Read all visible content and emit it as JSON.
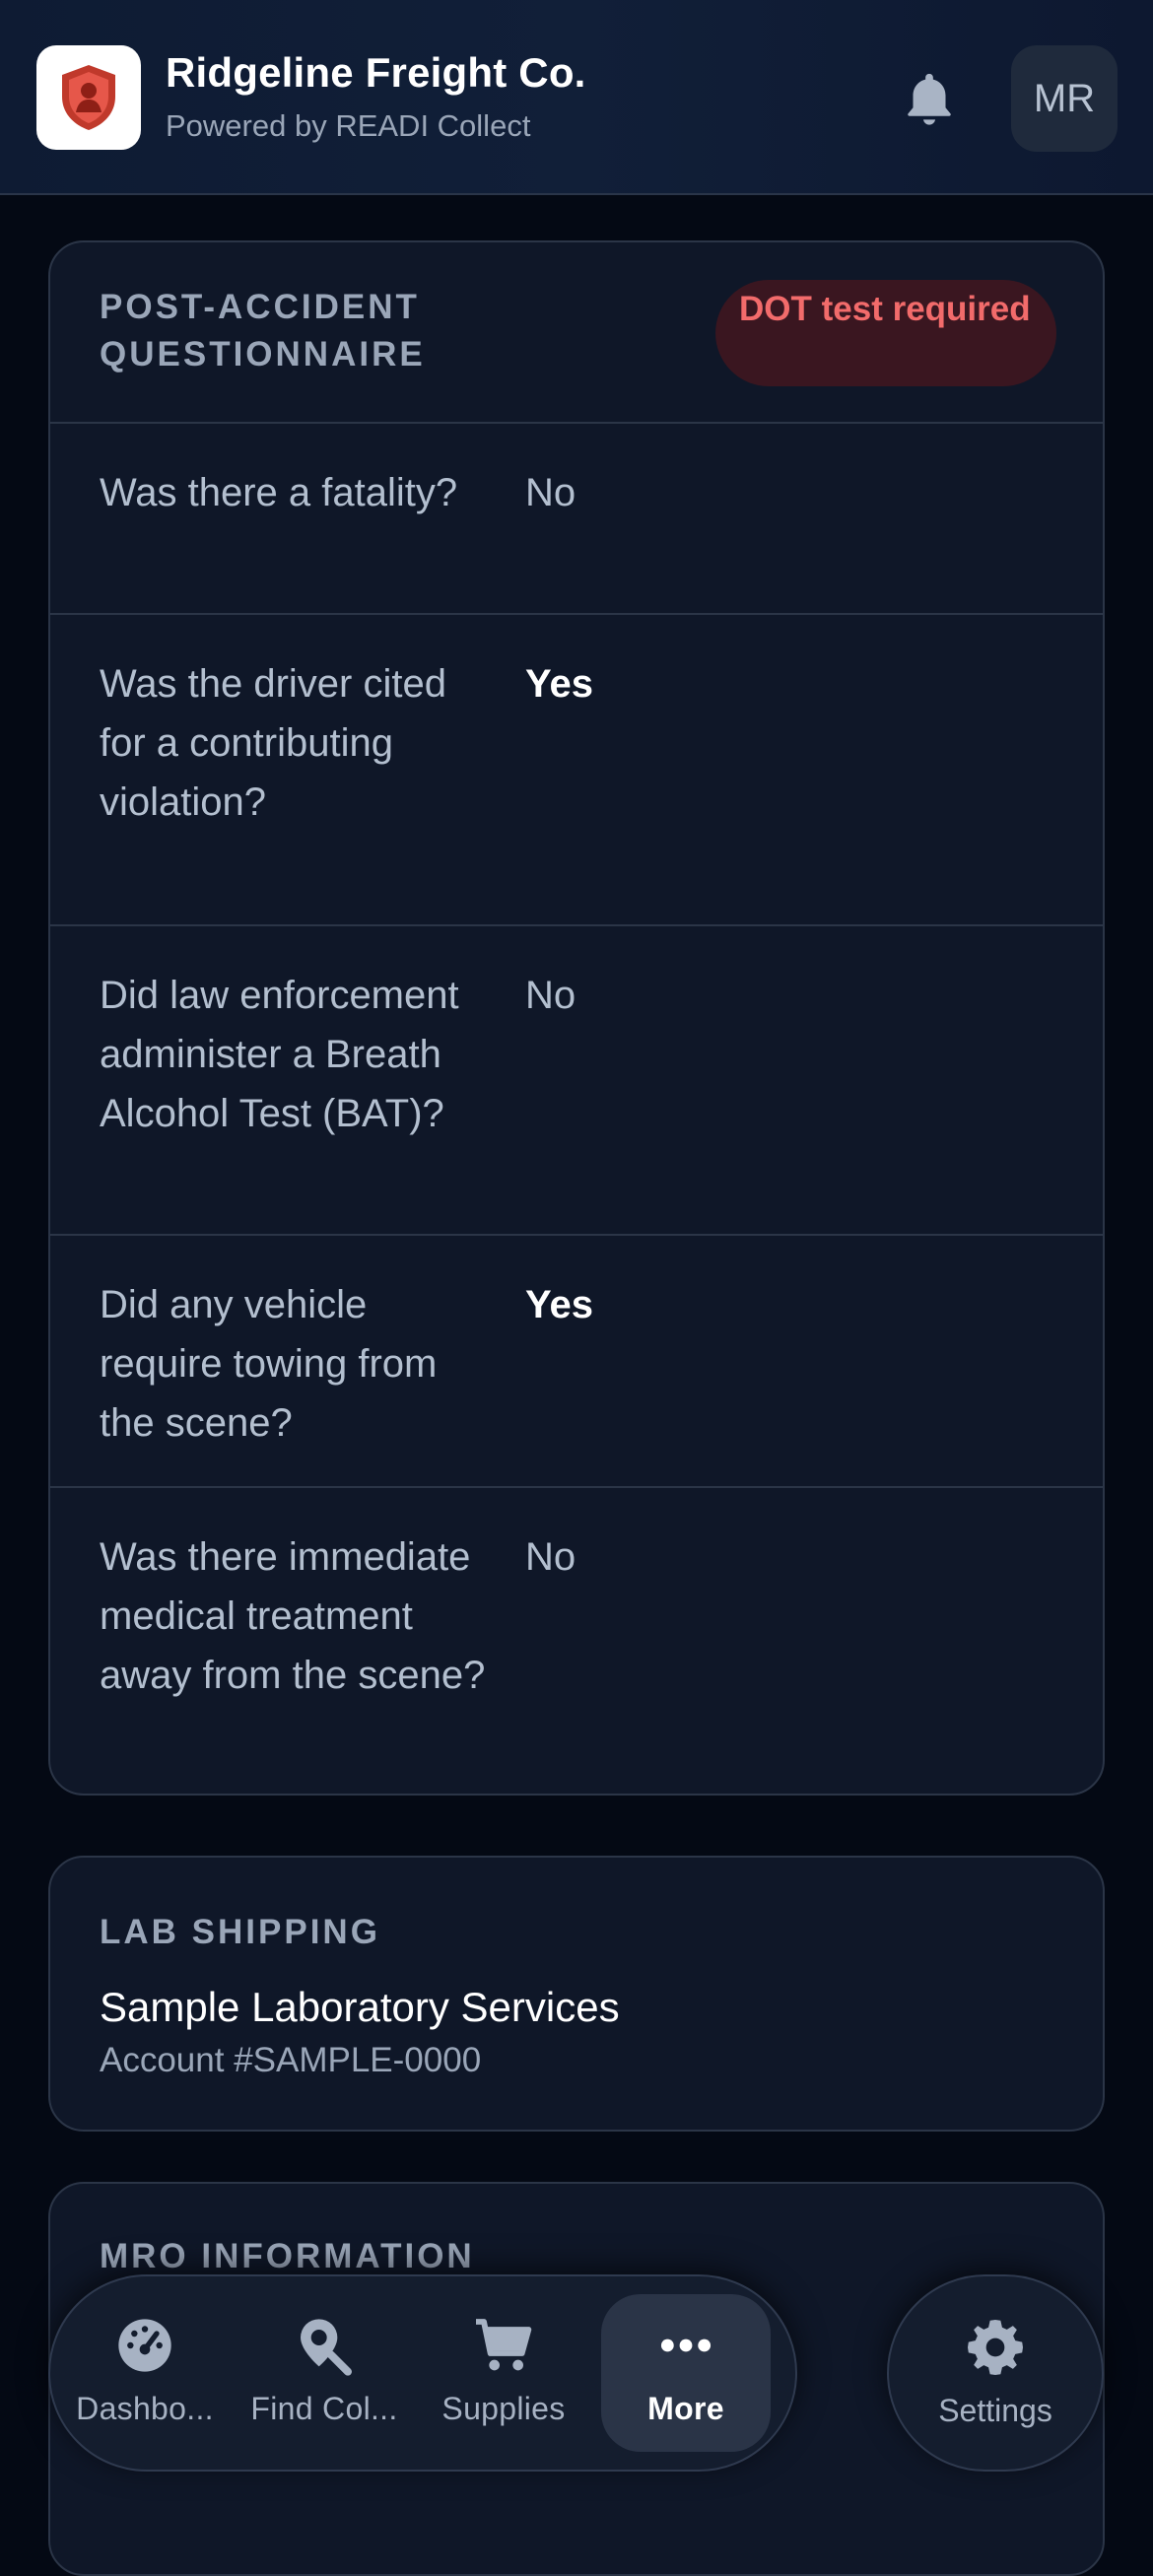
{
  "header": {
    "title": "Ridgeline Freight Co.",
    "subtitle": "Powered by READI Collect",
    "avatar_initials": "MR",
    "logo_icon": "shield-person-icon",
    "notification_icon": "bell-icon"
  },
  "questionnaire": {
    "label": "POST-ACCIDENT QUESTIONNAIRE",
    "badge": "DOT test required",
    "rows": [
      {
        "question": "Was there a fatality?",
        "answer": "No"
      },
      {
        "question": "Was the driver cited for a contributing violation?",
        "answer": "Yes"
      },
      {
        "question": "Did law enforcement administer a Breath Alcohol Test (BAT)?",
        "answer": "No"
      },
      {
        "question": "Did any vehicle require towing from the scene?",
        "answer": "Yes"
      },
      {
        "question": "Was there immediate medical treatment away from the scene?",
        "answer": "No"
      }
    ]
  },
  "lab_shipping": {
    "label": "LAB SHIPPING",
    "name": "Sample Laboratory Services",
    "account": "Account #SAMPLE-0000"
  },
  "mro": {
    "label": "MRO INFORMATION"
  },
  "nav": {
    "items": [
      {
        "label": "Dashbo...",
        "icon": "gauge-icon"
      },
      {
        "label": "Find Col...",
        "icon": "location-search-icon"
      },
      {
        "label": "Supplies",
        "icon": "cart-icon"
      },
      {
        "label": "More",
        "icon": "ellipsis-icon"
      }
    ],
    "settings": {
      "label": "Settings",
      "icon": "gear-icon"
    }
  },
  "colors": {
    "background": "#040914",
    "card": "#0f1728",
    "badge_text": "#f26b6b",
    "badge_bg": "#3a1620"
  }
}
